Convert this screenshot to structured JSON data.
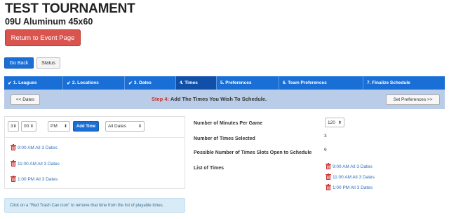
{
  "page": {
    "title": "TEST TOURNAMENT",
    "subtitle": "09U Aluminum 45x60",
    "return_label": "Return to Event Page",
    "go_back_label": "Go Back",
    "status_label": "Status"
  },
  "steps": [
    {
      "label": "1. Leagues",
      "done": true
    },
    {
      "label": "2. Locations",
      "done": true
    },
    {
      "label": "3. Dates",
      "done": true
    },
    {
      "label": "4. Times",
      "done": false,
      "active": true
    },
    {
      "label": "5. Preferences",
      "done": false
    },
    {
      "label": "6. Team Preferences",
      "done": false
    },
    {
      "label": "7. Finalize Schedule",
      "done": false
    }
  ],
  "stepbar": {
    "prev_label": "<< Dates",
    "step_prefix": "Step 4:",
    "step_text": " Add The Times You Wish To Schedule.",
    "next_label": "Set Preferences >>"
  },
  "picker": {
    "hour": "3",
    "minute": "00",
    "ampm": "PM",
    "add_label": "Add Time",
    "dates": "All Dates"
  },
  "times_list": [
    "9:00 AM All 3 Dates",
    "11:00 AM All 3 Dates",
    "1:00 PM All 3 Dates"
  ],
  "info": "Click on a \"Red Trash Can icon\" to remove that time from the list of playable times.",
  "summary": {
    "minutes_label": "Number of Minutes Per Game",
    "minutes_value": "120",
    "selected_label": "Number of Times Selected",
    "selected_value": "3",
    "slots_label": "Possible Number of Times Slots Open to Schedule",
    "slots_value": "9",
    "list_label": "List of Times",
    "list": [
      "9:00 AM All 3 Dates",
      "11:00 AM All 3 Dates",
      "1:00 PM All 3 Dates"
    ]
  },
  "colors": {
    "primary": "#1a6fd6",
    "active_step": "#1150a8",
    "danger": "#d9534f",
    "stepbar": "#b9cde9",
    "info_bg": "#d9ebf6",
    "link": "#2a6ebb"
  },
  "icons": {
    "trash": "trash-icon",
    "check": "check-icon",
    "dropdown": "chevron-down-icon"
  }
}
